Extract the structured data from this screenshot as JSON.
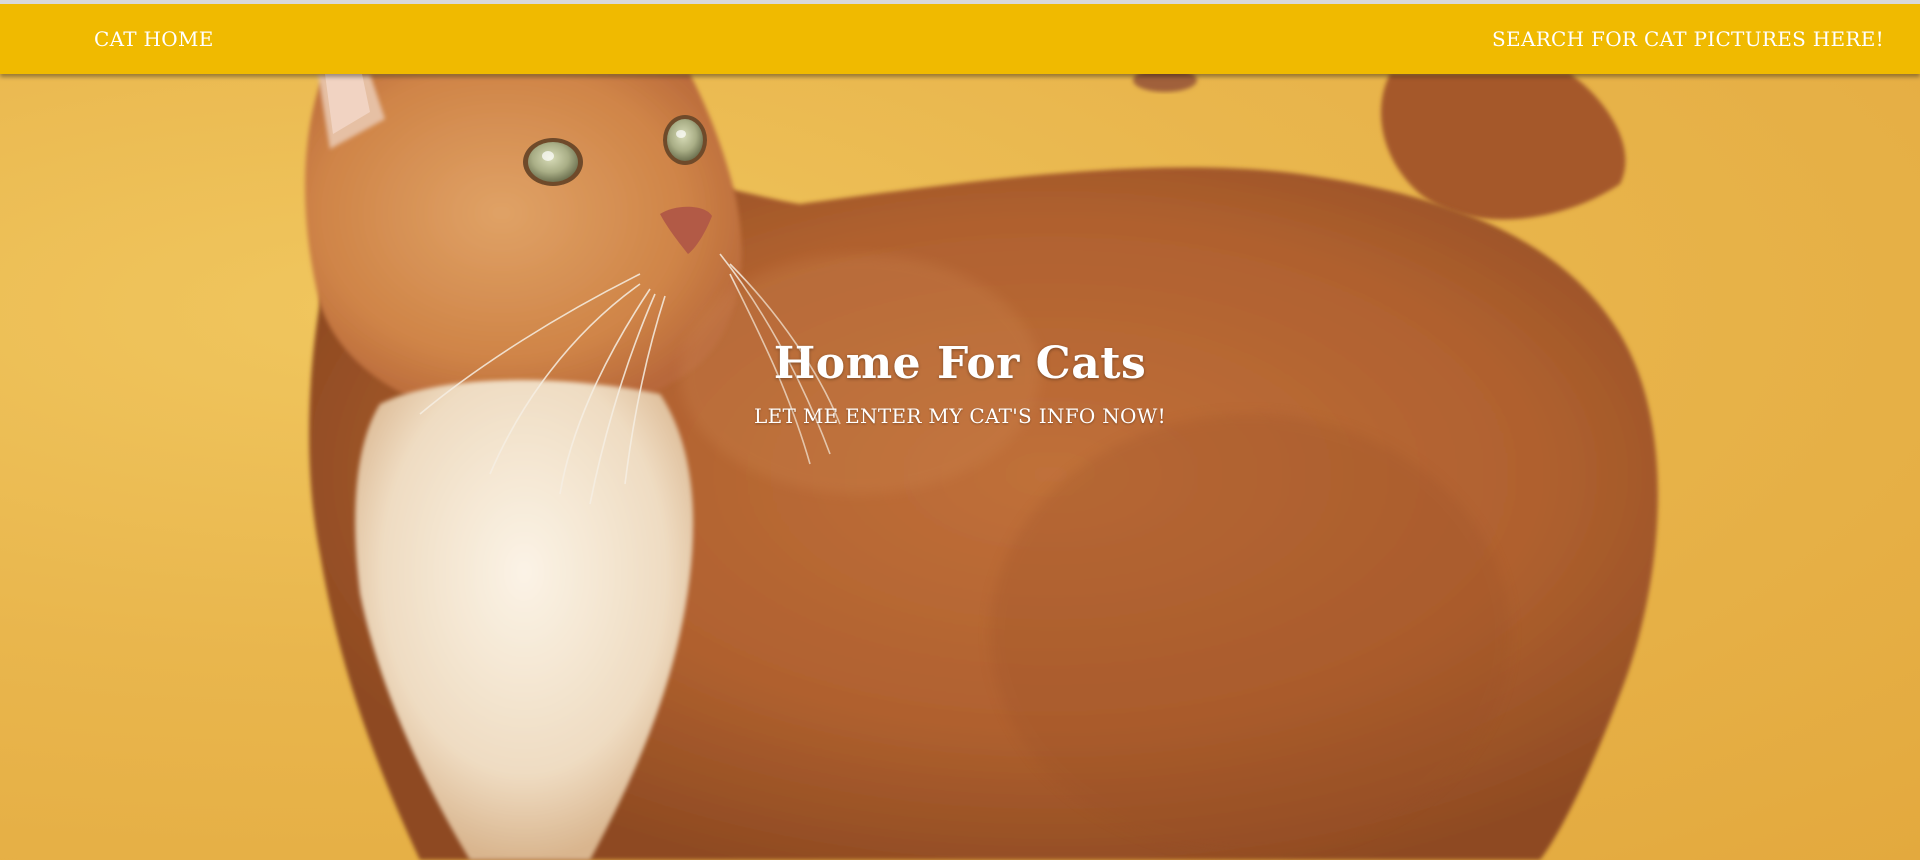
{
  "nav": {
    "home_label": "CAT HOME",
    "search_label": "SEARCH FOR CAT PICTURES HERE!"
  },
  "hero": {
    "title": "Home For Cats",
    "subtitle": "LET ME ENTER MY CAT'S INFO NOW!",
    "background_image": "orange-tabby-cat-photo"
  },
  "colors": {
    "navbar": "#f0ba00",
    "background": "#e8b54c",
    "text": "#ffffff",
    "cat_fur": "#c6743a",
    "cat_chest": "#f2e6d4"
  }
}
